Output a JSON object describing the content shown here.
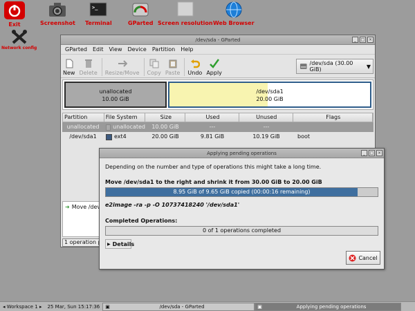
{
  "desktop": {
    "icons": [
      {
        "label": "Exit",
        "icon": "power-icon",
        "color": "#d40000"
      },
      {
        "label": "Screenshot",
        "icon": "camera-icon"
      },
      {
        "label": "Terminal",
        "icon": "terminal-icon"
      },
      {
        "label": "GParted",
        "icon": "gparted-icon"
      },
      {
        "label": "Screen resolution",
        "icon": "monitor-icon"
      },
      {
        "label": "Web Browser",
        "icon": "globe-icon"
      },
      {
        "label": "Network config",
        "icon": "tools-icon"
      }
    ]
  },
  "main_window": {
    "title": "/dev/sda - GParted",
    "menu": [
      "GParted",
      "Edit",
      "View",
      "Device",
      "Partition",
      "Help"
    ],
    "toolbar": {
      "new": "New",
      "delete": "Delete",
      "resize_move": "Resize/Move",
      "copy": "Copy",
      "paste": "Paste",
      "undo": "Undo",
      "apply": "Apply"
    },
    "device_selector": "/dev/sda   (30.00 GiB)",
    "graph": {
      "unallocated_label": "unallocated",
      "unallocated_size": "10.00 GiB",
      "partition_label": "/dev/sda1",
      "partition_size": "20.00 GiB",
      "partition_used_fraction": 0.49
    },
    "table": {
      "headers": [
        "Partition",
        "File System",
        "Size",
        "Used",
        "Unused",
        "Flags"
      ],
      "rows": [
        {
          "partition": "unallocated",
          "fs": "unallocated",
          "size": "10.00 GiB",
          "used": "---",
          "unused": "---",
          "flags": "",
          "fs_color": "#a9a9a9"
        },
        {
          "partition": "/dev/sda1",
          "fs": "ext4",
          "size": "20.00 GiB",
          "used": "9.81 GiB",
          "unused": "10.19 GiB",
          "flags": "boot",
          "fs_color": "#3d5a80"
        }
      ]
    },
    "operations": [
      "Move /dev/"
    ],
    "status": "1 operation pen"
  },
  "dialog": {
    "title": "Applying pending operations",
    "info": "Depending on the number and type of operations this might take a long time.",
    "current_op": "Move /dev/sda1 to the right and shrink it from 30.00 GiB to 20.00 GiB",
    "progress_text": "8.95 GiB of 9.65 GiB copied (00:00:16 remaining)",
    "progress_fraction": 0.927,
    "command": "e2image -ra -p -O 10737418240 '/dev/sda1'",
    "completed_heading": "Completed Operations:",
    "completed_text": "0 of 1 operations completed",
    "details_label": "Details",
    "cancel_label": "Cancel"
  },
  "taskbar": {
    "workspace": "Workspace 1",
    "datetime": "25 Mar, Sun 15:17:36",
    "task1": "/dev/sda - GParted",
    "task2": "Applying pending operations"
  }
}
